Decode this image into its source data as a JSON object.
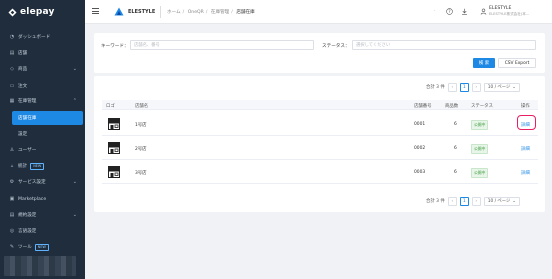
{
  "app": {
    "brand": "elepay"
  },
  "colors": {
    "sidebar_bg": "#1f2d3d",
    "accent": "#1e88e5",
    "success": "#43a047",
    "highlight": "#e91e63"
  },
  "sidebar": {
    "items": [
      {
        "label": "ダッシュボード",
        "icon": "dashboard-icon",
        "glyph": "◔"
      },
      {
        "label": "店舗",
        "icon": "store-icon",
        "glyph": "▤"
      },
      {
        "label": "商品",
        "icon": "product-icon",
        "glyph": "◇",
        "chevron": "⌄"
      },
      {
        "label": "注文",
        "icon": "order-icon",
        "glyph": "▭"
      },
      {
        "label": "在庫管理",
        "icon": "inventory-icon",
        "glyph": "▦",
        "chevron": "⌃"
      },
      {
        "label": "店舗在庫",
        "sub": true,
        "active": true
      },
      {
        "label": "設定",
        "sub": true
      },
      {
        "label": "ユーザー",
        "icon": "user-icon",
        "glyph": "♙"
      },
      {
        "label": "統計",
        "icon": "stats-icon",
        "glyph": "▵",
        "badge": "NEW"
      },
      {
        "label": "サービス設定",
        "icon": "service-icon",
        "glyph": "⚙",
        "chevron": "⌄"
      },
      {
        "label": "Marketplace",
        "icon": "marketplace-icon",
        "glyph": "▣"
      },
      {
        "label": "規約設定",
        "icon": "terms-icon",
        "glyph": "▤",
        "chevron": "⌄"
      },
      {
        "label": "言語設定",
        "icon": "language-icon",
        "glyph": "◎"
      },
      {
        "label": "ツール",
        "icon": "tool-icon",
        "glyph": "✎",
        "badge": "NEW"
      }
    ]
  },
  "header": {
    "org_name": "ELESTYLE",
    "breadcrumb": [
      "ホーム",
      "OneQR",
      "在庫管理",
      "店舗在庫"
    ],
    "user_name": "ELESTYLE",
    "user_sub": "ELESTYLE株式会社(本..."
  },
  "filter": {
    "keyword_label": "キーワード：",
    "keyword_placeholder": "店舗名、番号",
    "status_label": "ステータス：",
    "status_placeholder": "選択してください",
    "search_button": "検 索",
    "export_button": "CSV Export"
  },
  "pagination": {
    "total_text": "合計 3 件",
    "prev": "‹",
    "current_page": "1",
    "next": "›",
    "page_size": "10 / ページ",
    "size_chevron": "⌄"
  },
  "table": {
    "columns": {
      "logo": "ロゴ",
      "name": "店舗名",
      "number": "店舗番号",
      "count": "商品数",
      "status": "ステータス",
      "action": "操作"
    },
    "rows": [
      {
        "name": "1号店",
        "number": "0001",
        "count": "6",
        "status": "公開中",
        "action": "詳細"
      },
      {
        "name": "2号店",
        "number": "0002",
        "count": "6",
        "status": "公開中",
        "action": "詳細"
      },
      {
        "name": "3号店",
        "number": "0003",
        "count": "6",
        "status": "公開中",
        "action": "詳細"
      }
    ]
  }
}
